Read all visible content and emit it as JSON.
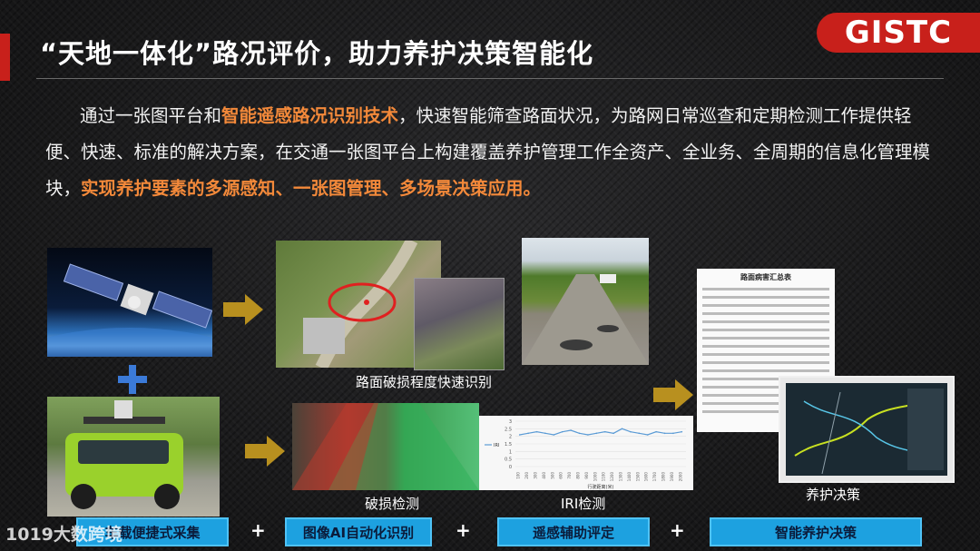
{
  "header": {
    "title": "“天地一体化”路况评价，助力养护决策智能化",
    "logo": "GISTC"
  },
  "intro": {
    "p1": "通过一张图平台和",
    "hl1": "智能遥感路况识别技术",
    "p2": "，快速智能筛查路面状况，为路网日常巡查和定期检测工作提供轻便、快速、标准的解决方案，在交通一张图平台上构建覆盖养护管理工作全资产、全业务、全周期的信息化管理模块，",
    "hl2": "实现养护要素的多源感知、一张图管理、多场景决策应用。"
  },
  "captions": {
    "aerial": "路面破损程度快速识别",
    "damage": "破损检测",
    "iri": "IRI检测",
    "decision": "养护决策"
  },
  "doc": {
    "title": "路面病害汇总表"
  },
  "chart_data": {
    "type": "line",
    "x_ticks": [
      "100",
      "200",
      "300",
      "400",
      "500",
      "600",
      "700",
      "800",
      "900",
      "1000",
      "1100",
      "1200",
      "1300",
      "1400",
      "1500",
      "1600",
      "1700",
      "1800",
      "1900",
      "2000"
    ],
    "values": [
      2.1,
      2.2,
      2.3,
      2.2,
      2.1,
      2.3,
      2.4,
      2.2,
      2.1,
      2.2,
      2.3,
      2.2,
      2.5,
      2.3,
      2.2,
      2.1,
      2.3,
      2.2,
      2.2,
      2.3
    ],
    "ylim": [
      0,
      3
    ],
    "y_ticks": [
      "0",
      "0.5",
      "1",
      "1.5",
      "2",
      "2.5",
      "3"
    ],
    "xlabel": "行驶距离(米)",
    "legend": "IRI",
    "line_color": "#5b9bd5"
  },
  "bottom": {
    "b1": "车载便捷式采集",
    "b2": "图像AI自动化识别",
    "b3": "遥感辅助评定",
    "b4": "智能养护决策",
    "plus": "+"
  },
  "watermark": "1019大数跨境"
}
